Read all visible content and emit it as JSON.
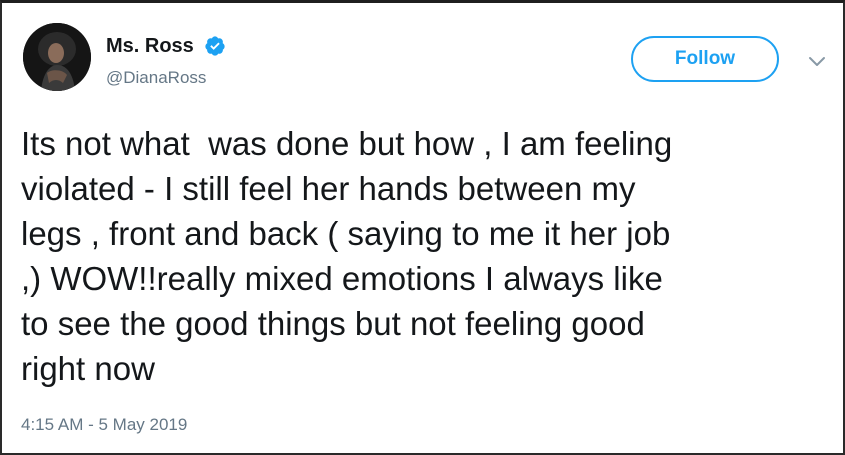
{
  "user": {
    "display_name": "Ms. Ross",
    "handle": "@DianaRoss",
    "verified": true
  },
  "follow_button": {
    "label": "Follow"
  },
  "tweet": {
    "text": "Its not what  was done but how , I am feeling\nviolated - I still feel her hands between my\nlegs , front and back ( saying to me it her job\n,) WOW!!really mixed emotions I always like\nto see the good things but not feeling good\nright now",
    "timestamp": "4:15 AM - 5 May 2019"
  },
  "icons": {
    "verified": "verified-badge-icon",
    "menu": "chevron-down-icon"
  },
  "colors": {
    "accent": "#1da1f2",
    "secondary_text": "#657786",
    "primary_text": "#14171a"
  }
}
